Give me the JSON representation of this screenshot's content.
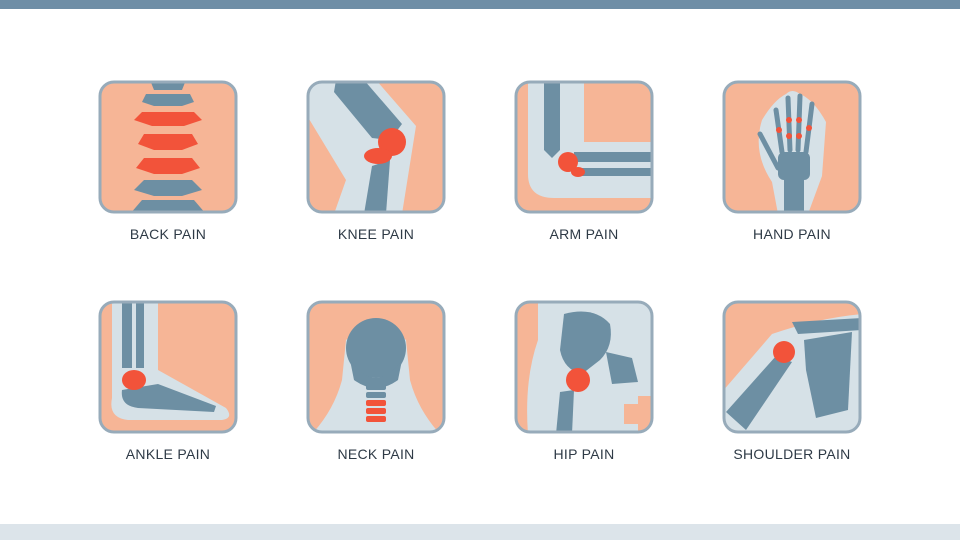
{
  "colors": {
    "bar_top": "#6f8ea6",
    "bar_bottom": "#dce4ea",
    "frame": "#97abba",
    "skin": "#f6b596",
    "halo": "#d6e1e7",
    "bone": "#6d8fa3",
    "pain": "#f2533a",
    "label": "#2e3a46"
  },
  "tiles": [
    {
      "label": "BACK PAIN",
      "icon": "spine-icon"
    },
    {
      "label": "KNEE PAIN",
      "icon": "knee-icon"
    },
    {
      "label": "ARM PAIN",
      "icon": "elbow-icon"
    },
    {
      "label": "HAND PAIN",
      "icon": "hand-icon"
    },
    {
      "label": "ANKLE PAIN",
      "icon": "ankle-icon"
    },
    {
      "label": "NECK PAIN",
      "icon": "neck-icon"
    },
    {
      "label": "HIP PAIN",
      "icon": "hip-icon"
    },
    {
      "label": "SHOULDER PAIN",
      "icon": "shoulder-icon"
    }
  ]
}
